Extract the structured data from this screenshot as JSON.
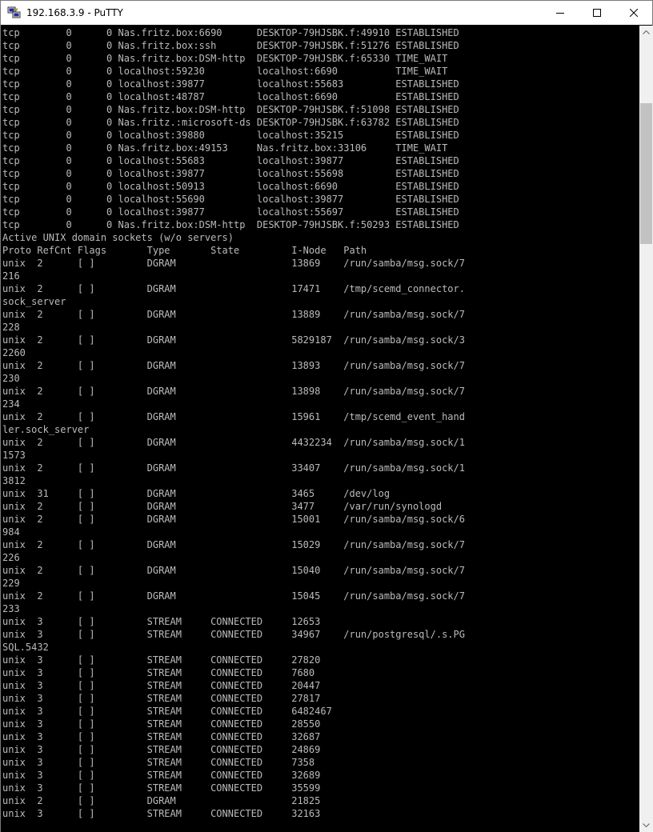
{
  "window": {
    "title": "192.168.3.9 - PuTTY"
  },
  "icons": {
    "app": "putty-icon",
    "minimize": "minimize-icon",
    "maximize": "maximize-icon",
    "close": "close-icon",
    "scroll_up": "chevron-up-icon",
    "scroll_down": "chevron-down-icon"
  },
  "colors": {
    "terminal_background": "#000000",
    "terminal_text": "#bbbbbb",
    "titlebar": "#ffffff"
  },
  "scrollbar": {
    "position_fraction": 0.1
  },
  "terminal_lines": [
    "tcp        0      0 Nas.fritz.box:6690      DESKTOP-79HJSBK.f:49910 ESTABLISHED",
    "tcp        0      0 Nas.fritz.box:ssh       DESKTOP-79HJSBK.f:51276 ESTABLISHED",
    "tcp        0      0 Nas.fritz.box:DSM-http  DESKTOP-79HJSBK.f:65330 TIME_WAIT",
    "tcp        0      0 localhost:59230         localhost:6690          TIME_WAIT",
    "tcp        0      0 localhost:39877         localhost:55683         ESTABLISHED",
    "tcp        0      0 localhost:48787         localhost:6690          ESTABLISHED",
    "tcp        0      0 Nas.fritz.box:DSM-http  DESKTOP-79HJSBK.f:51098 ESTABLISHED",
    "tcp        0      0 Nas.fritz.:microsoft-ds DESKTOP-79HJSBK.f:63782 ESTABLISHED",
    "tcp        0      0 localhost:39880         localhost:35215         ESTABLISHED",
    "tcp        0      0 Nas.fritz.box:49153     Nas.fritz.box:33106     TIME_WAIT",
    "tcp        0      0 localhost:55683         localhost:39877         ESTABLISHED",
    "tcp        0      0 localhost:39877         localhost:55698         ESTABLISHED",
    "tcp        0      0 localhost:50913         localhost:6690          ESTABLISHED",
    "tcp        0      0 localhost:55690         localhost:39877         ESTABLISHED",
    "tcp        0      0 localhost:39877         localhost:55697         ESTABLISHED",
    "tcp        0      0 Nas.fritz.box:DSM-http  DESKTOP-79HJSBK.f:50293 ESTABLISHED",
    "Active UNIX domain sockets (w/o servers)",
    "Proto RefCnt Flags       Type       State         I-Node   Path",
    "unix  2      [ ]         DGRAM                    13869    /run/samba/msg.sock/7",
    "216",
    "unix  2      [ ]         DGRAM                    17471    /tmp/scemd_connector.",
    "sock_server",
    "unix  2      [ ]         DGRAM                    13889    /run/samba/msg.sock/7",
    "228",
    "unix  2      [ ]         DGRAM                    5829187  /run/samba/msg.sock/3",
    "2260",
    "unix  2      [ ]         DGRAM                    13893    /run/samba/msg.sock/7",
    "230",
    "unix  2      [ ]         DGRAM                    13898    /run/samba/msg.sock/7",
    "234",
    "unix  2      [ ]         DGRAM                    15961    /tmp/scemd_event_hand",
    "ler.sock_server",
    "unix  2      [ ]         DGRAM                    4432234  /run/samba/msg.sock/1",
    "1573",
    "unix  2      [ ]         DGRAM                    33407    /run/samba/msg.sock/1",
    "3812",
    "unix  31     [ ]         DGRAM                    3465     /dev/log",
    "unix  2      [ ]         DGRAM                    3477     /var/run/synologd",
    "unix  2      [ ]         DGRAM                    15001    /run/samba/msg.sock/6",
    "984",
    "unix  2      [ ]         DGRAM                    15029    /run/samba/msg.sock/7",
    "226",
    "unix  2      [ ]         DGRAM                    15040    /run/samba/msg.sock/7",
    "229",
    "unix  2      [ ]         DGRAM                    15045    /run/samba/msg.sock/7",
    "233",
    "unix  3      [ ]         STREAM     CONNECTED     12653",
    "unix  3      [ ]         STREAM     CONNECTED     34967    /run/postgresql/.s.PG",
    "SQL.5432",
    "unix  3      [ ]         STREAM     CONNECTED     27820",
    "unix  3      [ ]         STREAM     CONNECTED     7680",
    "unix  3      [ ]         STREAM     CONNECTED     20447",
    "unix  3      [ ]         STREAM     CONNECTED     27817",
    "unix  3      [ ]         STREAM     CONNECTED     6482467",
    "unix  3      [ ]         STREAM     CONNECTED     28550",
    "unix  3      [ ]         STREAM     CONNECTED     32687",
    "unix  3      [ ]         STREAM     CONNECTED     24869",
    "unix  3      [ ]         STREAM     CONNECTED     7358",
    "unix  3      [ ]         STREAM     CONNECTED     32689",
    "unix  3      [ ]         STREAM     CONNECTED     35599",
    "unix  2      [ ]         DGRAM                    21825",
    "unix  3      [ ]         STREAM     CONNECTED     32163"
  ]
}
